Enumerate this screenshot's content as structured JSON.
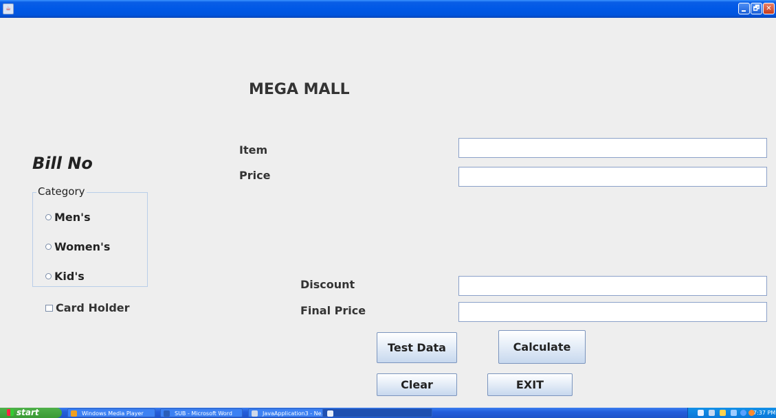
{
  "window": {
    "minimize": "",
    "maximize": "🗗",
    "close": "✕"
  },
  "form": {
    "title": "MEGA MALL",
    "bill_label": "Bill No",
    "item_label": "Item",
    "price_label": "Price",
    "discount_label": "Discount",
    "final_price_label": "Final Price",
    "item_value": "",
    "price_value": "",
    "discount_value": "",
    "final_price_value": "",
    "category": {
      "legend": "Category",
      "options": [
        "Men's",
        "Women's",
        "Kid's"
      ]
    },
    "card_holder_label": "Card Holder",
    "buttons": {
      "test_data": "Test Data",
      "calculate": "Calculate",
      "clear": "Clear",
      "exit": "EXIT"
    }
  },
  "taskbar": {
    "start": "start",
    "tasks": [
      "Windows Media Player",
      "SUB - Microsoft Word",
      "JavaApplication3 - Ne..."
    ],
    "clock": "7:37 PM"
  }
}
